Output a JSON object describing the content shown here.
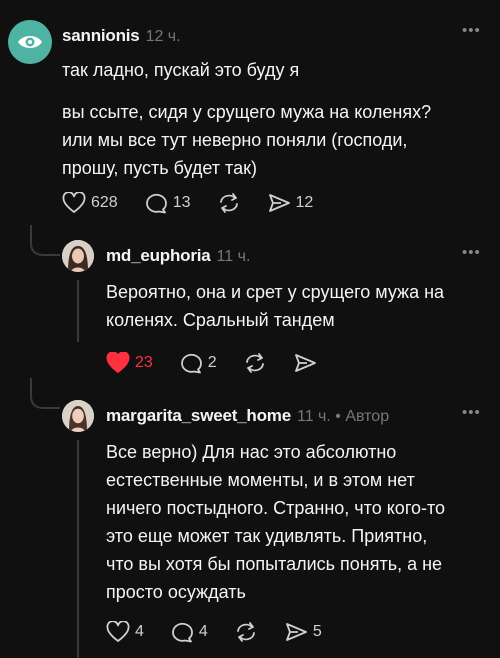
{
  "colors": {
    "background": "#101010",
    "text": "#f3f5f7",
    "muted": "#777777",
    "like_active": "#ff3040",
    "avatar_teal": "#4fb3a3"
  },
  "post1": {
    "username": "sannionis",
    "time": "12 ч.",
    "line1": "так ладно, пускай это буду я",
    "paragraph": [
      "вы ссыте, сидя у срущего мужа на коленях?",
      "или мы все тут неверно поняли (господи,",
      "прошу, пусть будет так)"
    ],
    "likes": "628",
    "replies": "13",
    "shares": "12",
    "icons": {
      "avatar": "eye-icon",
      "like": "heart-icon",
      "reply": "comment-icon",
      "repost": "repost-icon",
      "share": "send-icon",
      "more": "more-icon"
    }
  },
  "post2": {
    "username": "md_euphoria",
    "time": "11 ч.",
    "lines": [
      "Вероятно, она и срет у срущего мужа на",
      "коленях. Сральный тандем"
    ],
    "likes": "23",
    "replies": "2"
  },
  "post3": {
    "username": "margarita_sweet_home",
    "time": "11 ч.",
    "author_label": " • Автор",
    "lines": [
      "Все верно) Для нас это абсолютно",
      "естественные моменты, и в этом нет",
      "ничего постыдного. Странно, что кого-то",
      "это еще может так удивлять. Приятно,",
      "что вы хотя бы попытались понять, а не",
      "просто осуждать"
    ],
    "likes": "4",
    "replies": "4",
    "shares": "5"
  }
}
